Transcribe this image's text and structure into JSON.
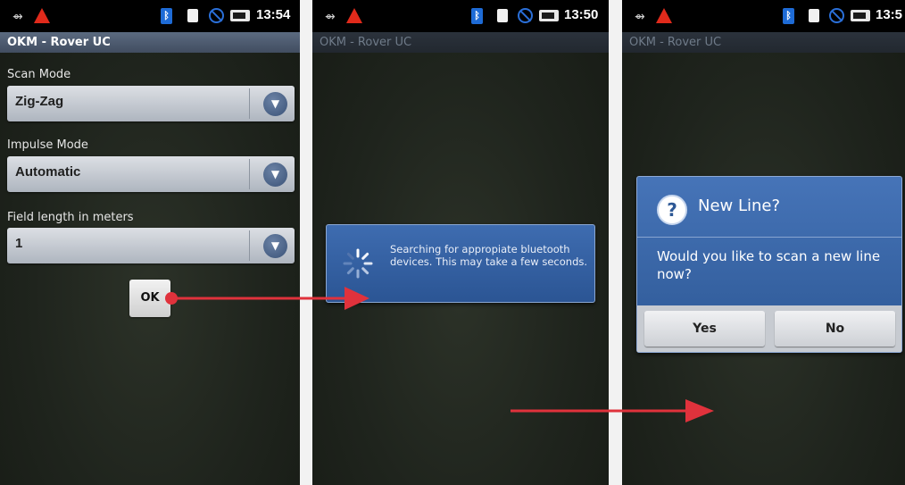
{
  "screen1": {
    "time": "13:54",
    "app_title": "OKM - Rover UC",
    "scan_mode": {
      "label": "Scan Mode",
      "value": "Zig-Zag"
    },
    "impulse_mode": {
      "label": "Impulse Mode",
      "value": "Automatic"
    },
    "field_length": {
      "label": "Field length in meters",
      "value": "1"
    },
    "ok_label": "OK"
  },
  "screen2": {
    "time": "13:50",
    "app_title": "OKM - Rover UC",
    "progress_message": "Searching for appropiate bluetooth devices. This may take a few seconds."
  },
  "screen3": {
    "time": "13:5",
    "app_title": "OKM - Rover UC",
    "dialog_title": "New Line?",
    "dialog_message": "Would you like to scan a new line now?",
    "yes_label": "Yes",
    "no_label": "No"
  },
  "colors": {
    "arrow": "#e0323c",
    "dialog_blue": "#2d5895",
    "title_bar": "#4b596e"
  },
  "icons": [
    "usb-icon",
    "warning-icon",
    "bluetooth-icon",
    "sim-icon",
    "no-signal-icon",
    "battery-icon",
    "chevron-down-icon",
    "spinner-icon",
    "question-icon"
  ]
}
